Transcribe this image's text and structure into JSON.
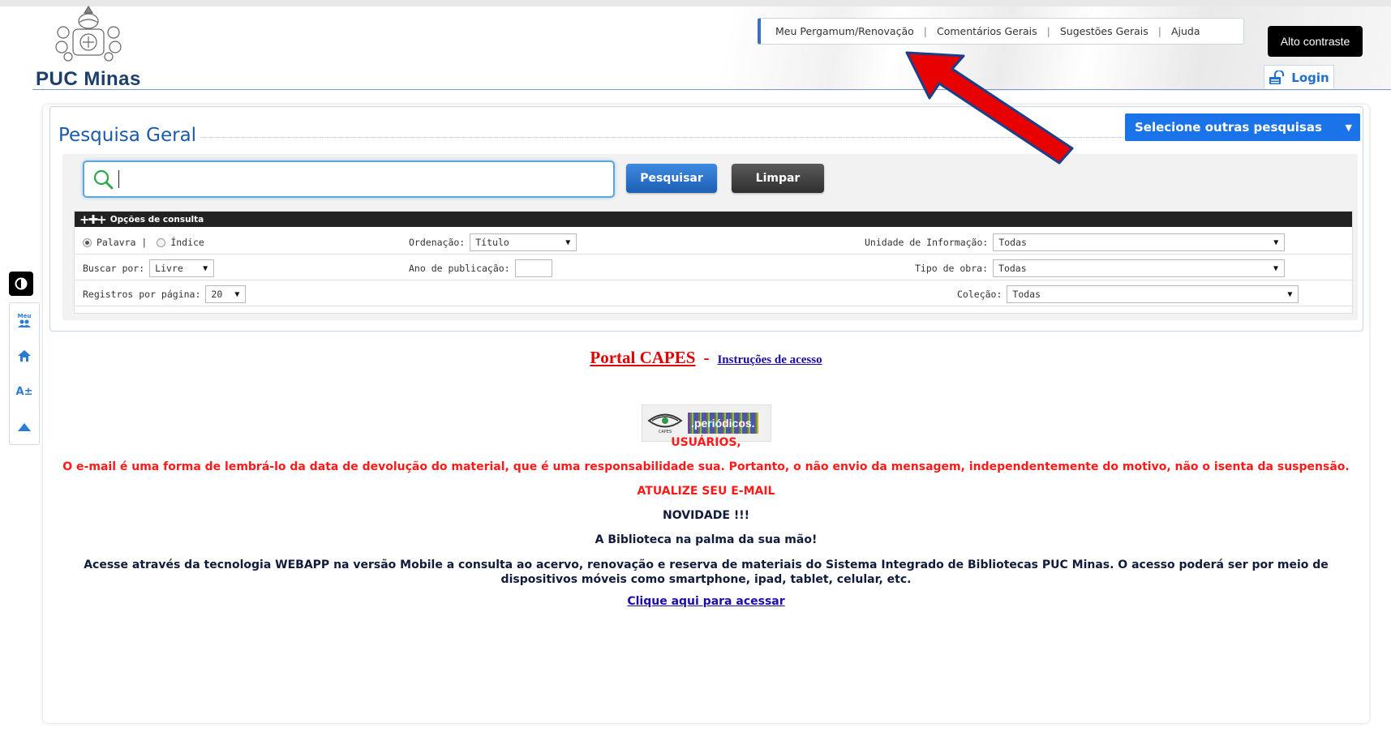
{
  "header": {
    "logo_text": "PUC Minas",
    "nav": [
      "Meu Pergamum/Renovação",
      "Comentários Gerais",
      "Sugestões Gerais",
      "Ajuda"
    ],
    "high_contrast_label": "Alto contraste",
    "login_label": "Login"
  },
  "search": {
    "title": "Pesquisa Geral",
    "other_searches_label": "Selecione outras pesquisas",
    "query_value": "",
    "search_button": "Pesquisar",
    "clear_button": "Limpar",
    "options_title": "Opções de consulta",
    "radio_word": "Palavra |",
    "radio_index": "Índice",
    "sort_label": "Ordenação:",
    "sort_value": "Título",
    "unit_label": "Unidade de Informação:",
    "unit_value": "Todas",
    "search_by_label": "Buscar por:",
    "search_by_value": "Livre",
    "pub_year_label": "Ano de publicação:",
    "pub_year_value": "",
    "work_type_label": "Tipo de obra:",
    "work_type_value": "Todas",
    "per_page_label": "Registros por página:",
    "per_page_value": "20",
    "collection_label": "Coleção:",
    "collection_value": "Todas"
  },
  "sidebar": {
    "meu_label": "Meu",
    "font_size_label": "A±"
  },
  "content": {
    "portal_capes": "Portal CAPES",
    "dash": "-",
    "instructions": "Instruções de acesso",
    "capes_logo_label": "CAPES",
    "periodicos_label": ".periódicos.",
    "users_heading": "USUÁRIOS,",
    "email_notice": "O e-mail é uma forma de lembrá-lo da data de devolução do material, que é uma responsabilidade sua. Portanto, o não envio da mensagem, independentemente do motivo, não o isenta da suspensão.",
    "update_email": "ATUALIZE SEU E-MAIL",
    "novelty": "NOVIDADE !!!",
    "library_hand": "A Biblioteca na palma da sua mão!",
    "webapp_text": "Acesse através da tecnologia WEBAPP na versão Mobile a consulta ao acervo, renovação e reserva de materiais do Sistema Integrado de Bibliotecas PUC Minas. O acesso poderá ser por meio de dispositivos móveis como smartphone, ipad, tablet, celular, etc.",
    "click_here": "Clique aqui para acessar"
  },
  "colors": {
    "accent_blue": "#1a73e8",
    "alert_red": "#ff1a1a",
    "annotation_arrow": "#e60000"
  }
}
